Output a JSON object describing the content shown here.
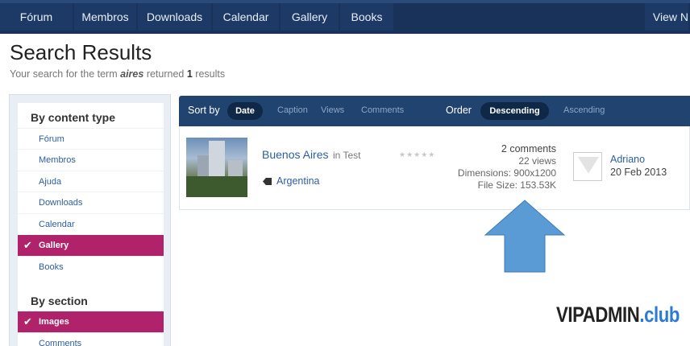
{
  "nav": {
    "items": [
      "Fórum",
      "Membros",
      "Downloads",
      "Calendar",
      "Gallery",
      "Books"
    ],
    "right_item": "View N"
  },
  "page": {
    "title": "Search Results",
    "subtitle_prefix": "Your search for the term",
    "term": "aires",
    "returned": "returned",
    "count": "1",
    "results_word": "results"
  },
  "sidebar": {
    "content_heading": "By content type",
    "content_items": [
      {
        "label": "Fórum"
      },
      {
        "label": "Membros"
      },
      {
        "label": "Ajuda"
      },
      {
        "label": "Downloads"
      },
      {
        "label": "Calendar"
      },
      {
        "label": "Gallery",
        "active": true
      },
      {
        "label": "Books"
      }
    ],
    "section_heading": "By section",
    "section_items": [
      {
        "label": "Images",
        "active": true
      },
      {
        "label": "Comments"
      }
    ]
  },
  "sortbar": {
    "sort_by_label": "Sort by",
    "sort_options": [
      "Date",
      "Caption",
      "Views",
      "Comments"
    ],
    "selected_sort": "Date",
    "order_label": "Order",
    "order_options": [
      "Descending",
      "Ascending"
    ],
    "selected_order": "Descending"
  },
  "result": {
    "title": "Buenos Aires",
    "in_word": "in",
    "category": "Test",
    "tag": "Argentina",
    "comments": "2 comments",
    "views": "22 views",
    "dimensions": "Dimensions: 900x1200",
    "file_size": "File Size: 153.53K",
    "author": "Adriano",
    "date": "20 Feb 2013",
    "rating": 0
  },
  "watermark": {
    "main": "VIPADMIN",
    "suffix": ".club"
  },
  "colors": {
    "nav_bg": "#19325a",
    "accent_active": "#b0236b",
    "sortbar_bg": "#21436f",
    "link": "#2d5ea0",
    "arrow": "#5b9bd5"
  }
}
